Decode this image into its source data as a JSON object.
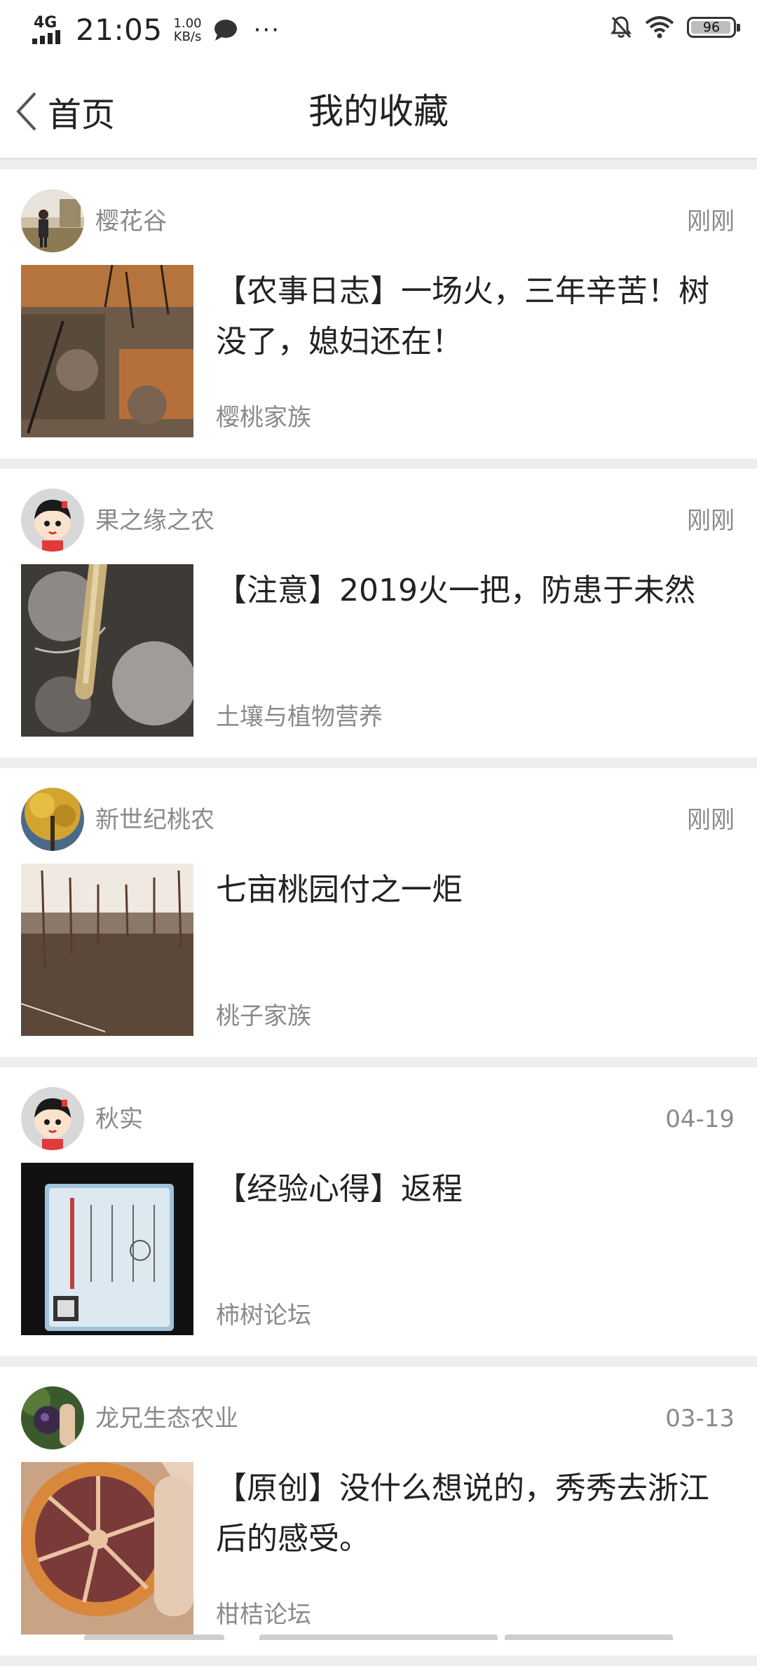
{
  "status": {
    "network": "4G",
    "time": "21:05",
    "speed_value": "1.00",
    "speed_unit": "KB/s",
    "battery": "96"
  },
  "nav": {
    "back_label": "首页",
    "title": "我的收藏"
  },
  "posts": [
    {
      "author": "樱花谷",
      "time": "刚刚",
      "title": "【农事日志】一场火，三年辛苦！树没了，媳妇还在！",
      "forum": "樱桃家族"
    },
    {
      "author": "果之缘之农",
      "time": "刚刚",
      "title": "【注意】2019火一把，防患于未然",
      "forum": "土壤与植物营养"
    },
    {
      "author": "新世纪桃农",
      "time": "刚刚",
      "title": "七亩桃园付之一炬",
      "forum": "桃子家族"
    },
    {
      "author": "秋实",
      "time": "04-19",
      "title": "【经验心得】返程",
      "forum": "柿树论坛"
    },
    {
      "author": "龙兄生态农业",
      "time": "03-13",
      "title": "【原创】没什么想说的，秀秀去浙江后的感受。",
      "forum": "柑桔论坛"
    }
  ]
}
